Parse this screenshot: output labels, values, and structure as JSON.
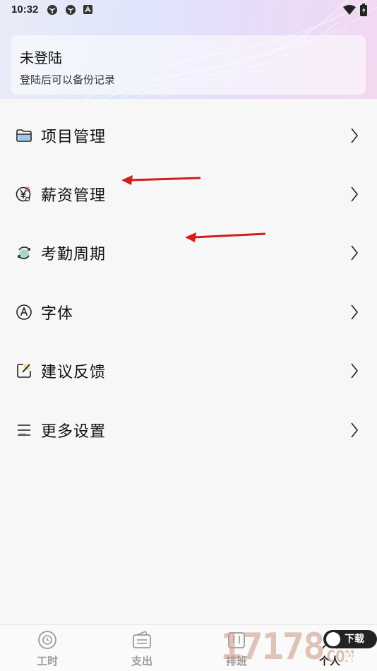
{
  "status_bar": {
    "time": "10:32",
    "icons": [
      "app-icon",
      "app-icon",
      "a-icon"
    ],
    "right_icons": [
      "wifi-icon",
      "battery-icon"
    ]
  },
  "login": {
    "title": "未登陆",
    "subtitle": "登陆后可以备份记录"
  },
  "menu": {
    "items": [
      {
        "label": "项目管理",
        "icon": "folder-icon"
      },
      {
        "label": "薪资管理",
        "icon": "yen-icon"
      },
      {
        "label": "考勤周期",
        "icon": "cycle-icon"
      },
      {
        "label": "字体",
        "icon": "font-a-icon"
      },
      {
        "label": "建议反馈",
        "icon": "edit-icon"
      },
      {
        "label": "更多设置",
        "icon": "settings-list-icon"
      }
    ]
  },
  "bottom_nav": {
    "items": [
      {
        "label": "工时",
        "icon": "clock-icon"
      },
      {
        "label": "支出",
        "icon": "wallet-icon"
      },
      {
        "label": "排班",
        "icon": "calendar-icon"
      },
      {
        "label": "个人",
        "icon": "person-icon"
      }
    ]
  },
  "watermark": {
    "number": "17178",
    "suffix": "COM",
    "badge": "下载站"
  },
  "colors": {
    "accent_red": "#d21d1d",
    "label_gray": "#9a9a9a"
  }
}
